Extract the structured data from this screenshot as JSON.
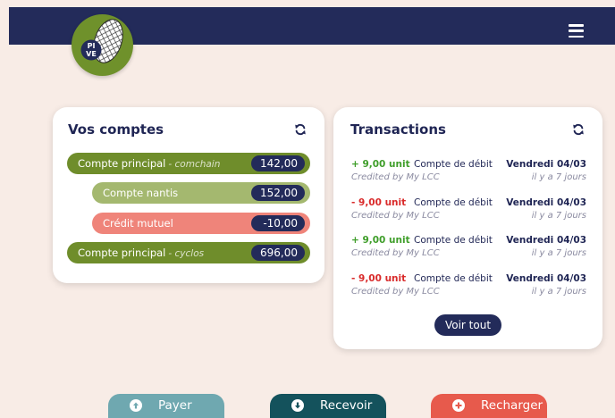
{
  "header": {
    "menu_icon": "hamburger-icon",
    "logo_text": "PIVE"
  },
  "accounts": {
    "title": "Vos comptes",
    "refresh_icon": "refresh-icon",
    "items": [
      {
        "name": "Compte principal",
        "sub": "- comchain",
        "amount": "142,00"
      },
      {
        "name": "Compte nantis",
        "sub": "",
        "amount": "152,00"
      },
      {
        "name": "Crédit mutuel",
        "sub": "",
        "amount": "-10,00"
      },
      {
        "name": "Compte principal",
        "sub": "- cyclos",
        "amount": "696,00"
      }
    ]
  },
  "transactions": {
    "title": "Transactions",
    "refresh_icon": "refresh-icon",
    "items": [
      {
        "amount": "+ 9,00 unit",
        "kind": "Compte de débit",
        "date": "Vendredi 04/03",
        "by": "Credited by My LCC",
        "ago": "il y a 7 jours"
      },
      {
        "amount": "- 9,00 unit",
        "kind": "Compte de débit",
        "date": "Vendredi 04/03",
        "by": "Credited by My LCC",
        "ago": "il y a 7 jours"
      },
      {
        "amount": "+ 9,00 unit",
        "kind": "Compte de débit",
        "date": "Vendredi 04/03",
        "by": "Credited by My LCC",
        "ago": "il y a 7 jours"
      },
      {
        "amount": "- 9,00 unit",
        "kind": "Compte de débit",
        "date": "Vendredi 04/03",
        "by": "Credited by My LCC",
        "ago": "il y a 7 jours"
      }
    ],
    "view_all": "Voir tout"
  },
  "actions": [
    {
      "label": "Payer",
      "icon": "arrow-up-circle-icon",
      "color": "#6fa8b0"
    },
    {
      "label": "Recevoir",
      "icon": "arrow-down-circle-icon",
      "color": "#14525c"
    },
    {
      "label": "Recharger",
      "icon": "plus-circle-icon",
      "color": "#e75a4c"
    }
  ],
  "colors": {
    "navy": "#232b5a",
    "green": "#6f8d2b",
    "light_green": "#a4b86f",
    "salmon": "#ef847a",
    "background": "#f8ece6"
  }
}
